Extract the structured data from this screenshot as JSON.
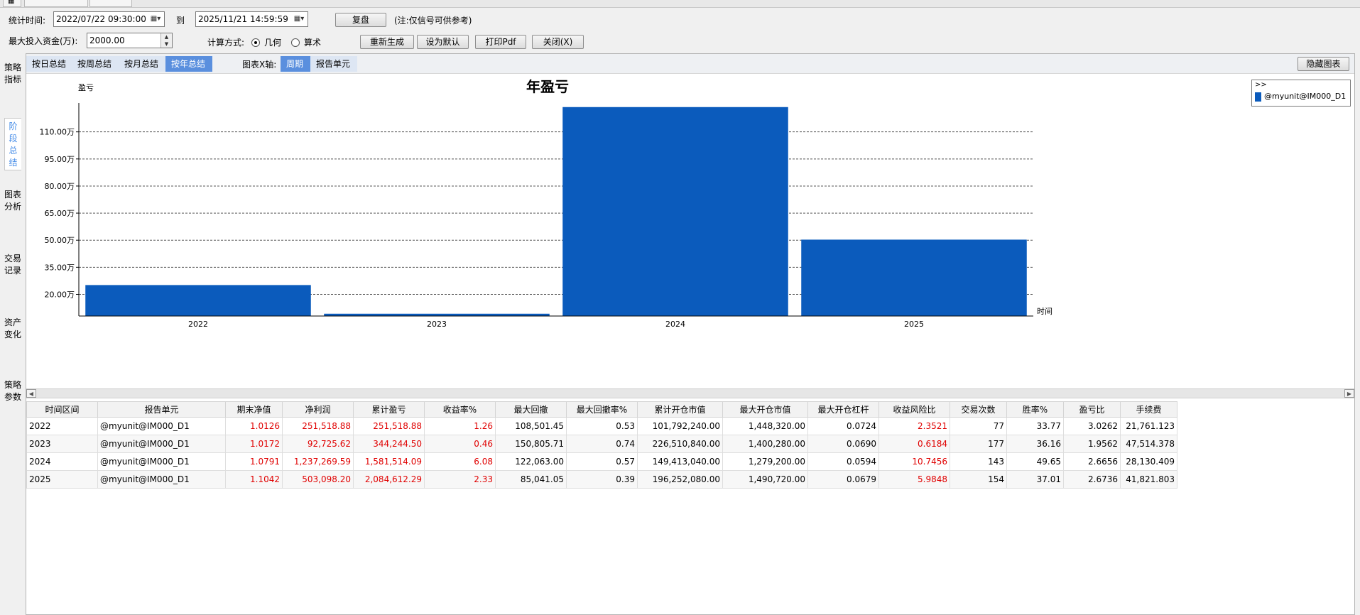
{
  "params": {
    "time_label": "统计时间:",
    "start_time": "2022/07/22 09:30:00",
    "to_label": "到",
    "end_time": "2025/11/21 14:59:59",
    "replay_button": "复盘",
    "note": "(注:仅信号可供参考)",
    "capital_label": "最大投入资金(万):",
    "capital_value": "2000.00",
    "calc_label": "计算方式:",
    "calc_options": [
      "几何",
      "算术"
    ],
    "calc_selected": "几何",
    "regen_button": "重新生成",
    "default_button": "设为默认",
    "print_button": "打印Pdf",
    "close_button": "关闭(X)"
  },
  "side_tabs": [
    "策略指标",
    "阶段总结",
    "图表分析",
    "交易记录",
    "资产变化",
    "策略参数"
  ],
  "side_tab_active": "阶段总结",
  "summary_tabs": [
    "按日总结",
    "按周总结",
    "按月总结",
    "按年总结"
  ],
  "summary_tab_active": "按年总结",
  "xaxis_label": "图表X轴:",
  "xaxis_tabs": [
    "周期",
    "报告单元"
  ],
  "xaxis_tab_active": "周期",
  "hide_chart_button": "隐藏图表",
  "chart_data": {
    "type": "bar",
    "title": "年盈亏",
    "ylabel": "盈亏",
    "xlabel": "时间",
    "categories": [
      "2022",
      "2023",
      "2024",
      "2025"
    ],
    "series": [
      {
        "name": "@myunit@IM000_D1",
        "values": [
          251518.88,
          92725.62,
          1237269.59,
          503098.2
        ]
      }
    ],
    "yticks": [
      200000,
      350000,
      500000,
      650000,
      800000,
      950000,
      1100000
    ],
    "ytick_labels": [
      "20.00万",
      "35.00万",
      "50.00万",
      "65.00万",
      "80.00万",
      "95.00万",
      "110.00万"
    ],
    "ylim": [
      80000,
      1260000
    ],
    "grid": true,
    "legend_position": "top-right",
    "legend_collapse": ">>",
    "bar_color": "#0b5bbc"
  },
  "table": {
    "columns": [
      "时间区间",
      "报告单元",
      "期末净值",
      "净利润",
      "累计盈亏",
      "收益率%",
      "最大回撤",
      "最大回撤率%",
      "累计开仓市值",
      "最大开仓市值",
      "最大开仓杠杆",
      "收益风险比",
      "交易次数",
      "胜率%",
      "盈亏比",
      "手续费"
    ],
    "rows": [
      [
        "2022",
        "@myunit@IM000_D1",
        "1.0126",
        "251,518.88",
        "251,518.88",
        "1.26",
        "108,501.45",
        "0.53",
        "101,792,240.00",
        "1,448,320.00",
        "0.0724",
        "2.3521",
        "77",
        "33.77",
        "3.0262",
        "21,761.123"
      ],
      [
        "2023",
        "@myunit@IM000_D1",
        "1.0172",
        "92,725.62",
        "344,244.50",
        "0.46",
        "150,805.71",
        "0.74",
        "226,510,840.00",
        "1,400,280.00",
        "0.0690",
        "0.6184",
        "177",
        "36.16",
        "1.9562",
        "47,514.378"
      ],
      [
        "2024",
        "@myunit@IM000_D1",
        "1.0791",
        "1,237,269.59",
        "1,581,514.09",
        "6.08",
        "122,063.00",
        "0.57",
        "149,413,040.00",
        "1,279,200.00",
        "0.0594",
        "10.7456",
        "143",
        "49.65",
        "2.6656",
        "28,130.409"
      ],
      [
        "2025",
        "@myunit@IM000_D1",
        "1.1042",
        "503,098.20",
        "2,084,612.29",
        "2.33",
        "85,041.05",
        "0.39",
        "196,252,080.00",
        "1,490,720.00",
        "0.0679",
        "5.9848",
        "154",
        "37.01",
        "2.6736",
        "41,821.803"
      ]
    ],
    "red_columns": [
      2,
      3,
      4,
      5,
      11
    ]
  }
}
